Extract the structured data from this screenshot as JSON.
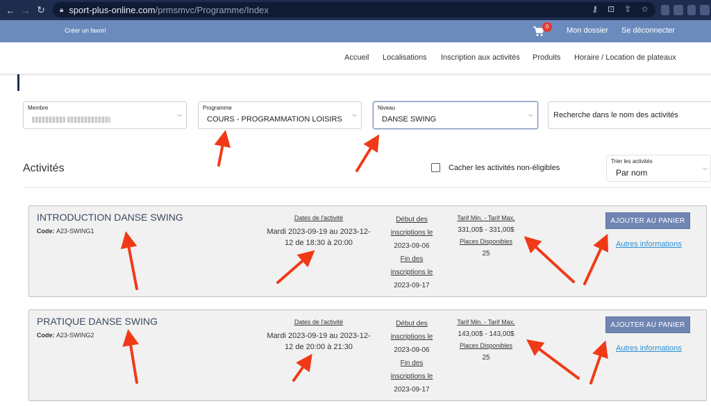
{
  "browser": {
    "url_host": "sport-plus-online.com",
    "url_path": "/prmsmvc/Programme/Index"
  },
  "topbar": {
    "favorite": "Créer un favori",
    "cart_count": "0",
    "my_file": "Mon dossier",
    "logout": "Se déconnecter"
  },
  "nav": {
    "items": [
      "Accueil",
      "Localisations",
      "Inscription aux activités",
      "Produits",
      "Horaire / Location de plateaux"
    ]
  },
  "filters": {
    "member_label": "Membre",
    "program_label": "Programme",
    "program_value": "COURS - PROGRAMMATION LOISIRS",
    "level_label": "Niveau",
    "level_value": "DANSE SWING",
    "search_placeholder": "Recherche dans le nom des activités"
  },
  "activities_heading": "Activités",
  "hide_ineligible_label": "Cacher les activités non-éligibles",
  "sort": {
    "label": "Trier les activités",
    "value": "Par nom"
  },
  "labels": {
    "code": "Code:",
    "dates": "Dates de l'activité",
    "start_line1": "Début des",
    "start_line2": "inscriptions le",
    "end_line1": "Fin des",
    "end_line2": "inscriptions le",
    "price": "Tarif Min. - Tarif Max.",
    "places": "Places Disponibles",
    "add_to_cart": "AJOUTER AU PANIER",
    "more_info": "Autres informations"
  },
  "activities": [
    {
      "title": "INTRODUCTION DANSE SWING",
      "code": "A23-SWING1",
      "dates_line1": "Mardi 2023-09-19 au 2023-12-",
      "dates_line2": "12 de 18:30 à 20:00",
      "start_date": "2023-09-06",
      "end_date": "2023-09-17",
      "price_range": "331,00$ - 331,00$",
      "places": "25"
    },
    {
      "title": "PRATIQUE DANSE SWING",
      "code": "A23-SWING2",
      "dates_line1": "Mardi 2023-09-19 au 2023-12-",
      "dates_line2": "12 de 20:00 à 21:30",
      "start_date": "2023-09-06",
      "end_date": "2023-09-17",
      "price_range": "143,00$ - 143,00$",
      "places": "25"
    }
  ],
  "colors": {
    "chrome": "#1e2c4e",
    "topbar": "#6b8bbd",
    "button": "#6f86b3",
    "link": "#2a8fd6",
    "annotation_arrow": "#f03a17"
  }
}
